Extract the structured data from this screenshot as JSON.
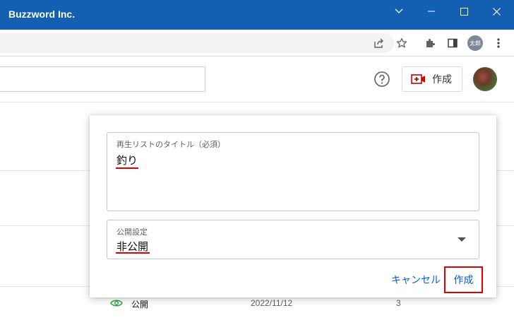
{
  "window": {
    "title": "Buzzword Inc."
  },
  "browser": {
    "profile_label": "太郎"
  },
  "header": {
    "create_label": "作成"
  },
  "table": {
    "row": {
      "visibility": "公開",
      "date": "2022/11/12",
      "count": "3"
    }
  },
  "dialog": {
    "title_field": {
      "label": "再生リストのタイトル（必須）",
      "value": "釣り"
    },
    "visibility_field": {
      "label": "公開設定",
      "value": "非公開"
    },
    "cancel_label": "キャンセル",
    "create_label": "作成"
  },
  "colors": {
    "titlebar": "#1360b2",
    "link_blue": "#065fd4",
    "highlight_red": "#e00000"
  },
  "icons": {
    "minimize": "minimize-icon",
    "maximize": "maximize-icon",
    "close": "close-icon",
    "tabs_dropdown": "chevron-down-icon",
    "share": "share-icon",
    "bookmark": "star-icon",
    "extensions": "puzzle-icon",
    "side_panel": "side-panel-icon",
    "menu": "kebab-menu-icon",
    "help": "help-icon",
    "create": "video-add-icon",
    "visibility": "eye-icon",
    "dropdown": "dropdown-arrow-icon"
  }
}
